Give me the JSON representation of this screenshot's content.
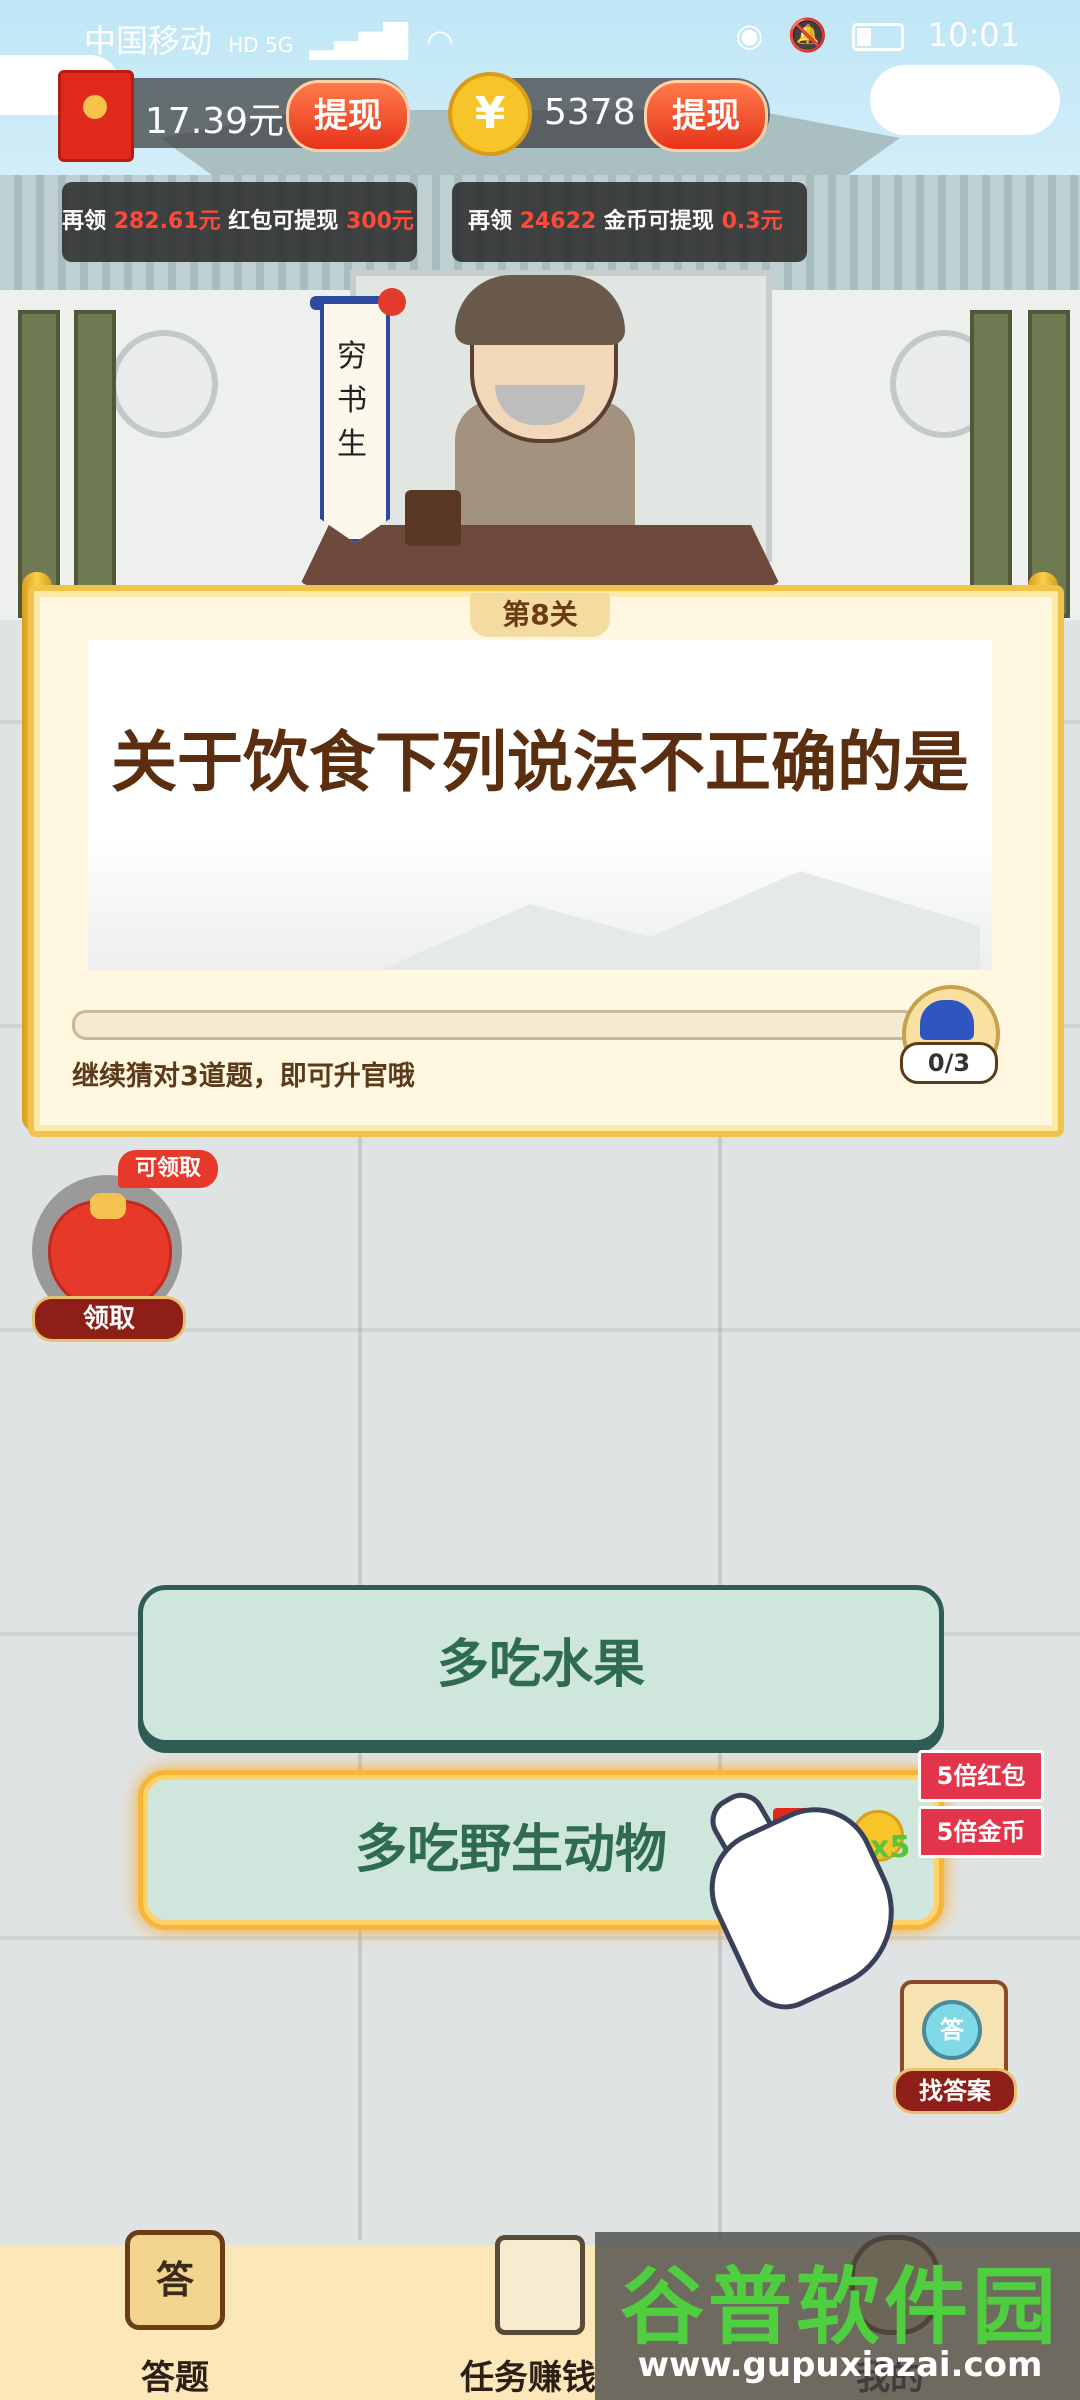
{
  "status_bar": {
    "carrier": "中国移动",
    "network": "HD 5G",
    "time": "10:01"
  },
  "currency": {
    "cash_amount": "17.39元",
    "cash_withdraw_label": "提现",
    "coin_amount": "5378",
    "coin_withdraw_label": "提现",
    "cash_tip": {
      "prefix": "再领",
      "amount": "282.61元",
      "middle": "红包可提现",
      "target": "300元"
    },
    "coin_tip": {
      "prefix": "再领",
      "amount": "24622",
      "middle": "金币可提现",
      "target": "0.3元"
    }
  },
  "scene": {
    "banner_text": "穷书生"
  },
  "question": {
    "level_label": "第8关",
    "text": "关于饮食下列说法不正确的是",
    "progress_count": "0/3",
    "progress_fraction": 0.0,
    "progress_hint": "继续猜对3道题，即可升官哦"
  },
  "lucky_bag": {
    "tag": "可领取",
    "button": "领取"
  },
  "answers": [
    {
      "label": "多吃水果"
    },
    {
      "label": "多吃野生动物"
    }
  ],
  "bonus": {
    "redpack_label": "5倍红包",
    "coin_label": "5倍金币",
    "multiplier": "x5"
  },
  "find_answer": {
    "icon_text": "答",
    "label": "找答案"
  },
  "nav": [
    {
      "icon_text": "答",
      "label": "答题"
    },
    {
      "icon_text": "",
      "label": "任务赚钱"
    },
    {
      "icon_text": "",
      "label": "我的"
    }
  ],
  "watermark": {
    "title": "谷普软件园",
    "url": "www.gupuxiazai.com"
  },
  "colors": {
    "accent_red": "#e6341c",
    "answer_green": "#cfe6dc",
    "panel_gold": "#f2c34a",
    "text_brown": "#5b2e10"
  }
}
